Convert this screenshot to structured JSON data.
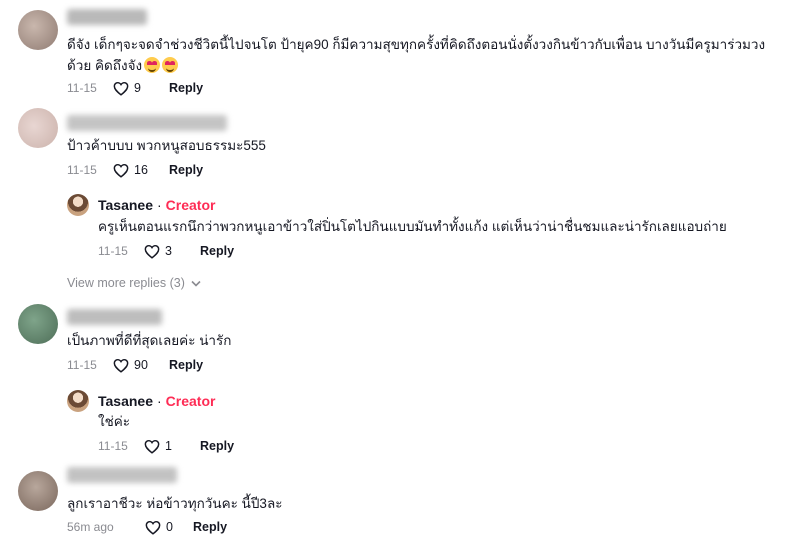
{
  "comments": [
    {
      "text": "ดีจัง เด็กๆจะจดจำช่วงชีวิตนี้ไปจนโต ป้ายุค90 ก็มีความสุขทุกครั้งที่คิดถึงตอนนั่งตั้งวงกินข้าวกับเพื่อน บางวันมีครูมาร่วมวง\nด้วย คิดถึงจัง",
      "date": "11-15",
      "likes": "9",
      "reply_label": "Reply"
    },
    {
      "text": "ป้าวค้าบบบ พวกหนูสอบธรรมะ555",
      "date": "11-15",
      "likes": "16",
      "reply_label": "Reply"
    },
    {
      "text": "เป็นภาพที่ดีที่สุดเลยค่ะ น่ารัก",
      "date": "11-15",
      "likes": "90",
      "reply_label": "Reply"
    },
    {
      "text": "ลูกเราอาชีวะ ห่อข้าวทุกวันคะ นี้ปี3ละ",
      "date": "56m ago",
      "likes": "0",
      "reply_label": "Reply"
    }
  ],
  "replies": [
    {
      "author": "Tasanee",
      "separator": "·",
      "badge": "Creator",
      "text": "ครูเห็นตอนแรกนึกว่าพวกหนูเอาข้าวใส่ปิ่นโตไปกินแบบมันทำทั้งแก้ง แต่เห็นว่าน่าชื่นชมและน่ารักเลยแอบถ่าย",
      "date": "11-15",
      "likes": "3",
      "reply_label": "Reply"
    },
    {
      "author": "Tasanee",
      "separator": "·",
      "badge": "Creator",
      "text": "ใช่ค่ะ",
      "date": "11-15",
      "likes": "1",
      "reply_label": "Reply"
    }
  ],
  "view_more": "View more replies (3)",
  "colors": {
    "creator": "#fe2c55",
    "meta": "#8a8b91",
    "text": "#161823"
  },
  "icons": {
    "like": "heart-outline-icon",
    "expand": "chevron-down-icon",
    "emoji": "smiling-face-with-heart-eyes-emoji"
  }
}
